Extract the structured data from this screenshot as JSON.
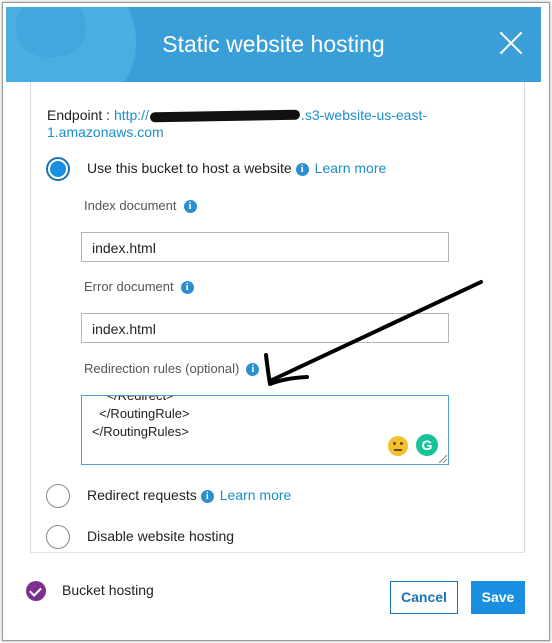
{
  "dialog": {
    "title": "Static website hosting",
    "endpoint_label": "Endpoint : ",
    "endpoint_prefix": "http://",
    "endpoint_suffix": ".s3-website-us-east-1.amazonaws.com"
  },
  "options": [
    {
      "label": "Use this bucket to host a website",
      "link": "Learn more",
      "selected": true
    },
    {
      "label": "Redirect requests",
      "link": "Learn more",
      "selected": false
    },
    {
      "label": "Disable website hosting",
      "selected": false
    }
  ],
  "fields": {
    "index_label": "Index document",
    "index_value": "index.html",
    "error_label": "Error document",
    "error_value": "index.html",
    "redirection_label": "Redirection rules (optional)",
    "redirection_lines": [
      "    </Redirect>",
      "  </RoutingRule>",
      "</RoutingRules>"
    ]
  },
  "footer": {
    "status_label": "Bucket hosting",
    "cancel": "Cancel",
    "save": "Save"
  },
  "colors": {
    "header": "#3a9fd8",
    "primary": "#1a8ee0",
    "link": "#1a8ec9",
    "status_check": "#7b2f8e"
  },
  "icons": {
    "info": "info-icon",
    "close": "close-icon",
    "emoji": "neutral-face-icon",
    "grammarly": "grammarly-icon"
  }
}
